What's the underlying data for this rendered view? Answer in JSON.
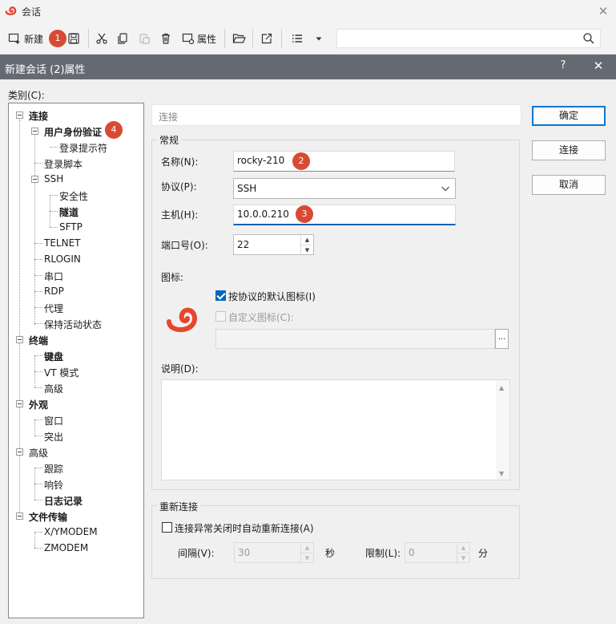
{
  "window": {
    "title": "会话",
    "close_symbol": "✕"
  },
  "toolbar": {
    "new_label": "新建",
    "properties_label": "属性",
    "search_placeholder": ""
  },
  "badges": {
    "b1": "1",
    "b2": "2",
    "b3": "3",
    "b4": "4"
  },
  "dialog": {
    "title": "新建会话 (2)属性",
    "help": "?",
    "close": "✕",
    "category_label": "类别(C):"
  },
  "tree": {
    "connection": "连接",
    "user_auth": "用户身份验证",
    "login_prompt": "登录提示符",
    "login_script": "登录脚本",
    "ssh": "SSH",
    "security": "安全性",
    "tunnel": "隧道",
    "sftp": "SFTP",
    "telnet": "TELNET",
    "rlogin": "RLOGIN",
    "serial": "串口",
    "rdp": "RDP",
    "proxy": "代理",
    "keepalive": "保持活动状态",
    "terminal": "终端",
    "keyboard": "键盘",
    "vt_mode": "VT 模式",
    "terminal_advanced": "高级",
    "appearance": "外观",
    "window": "窗口",
    "highlight": "突出",
    "advanced": "高级",
    "trace": "跟踪",
    "bell": "响铃",
    "logging": "日志记录",
    "file_transfer": "文件传输",
    "xymodem": "X/YMODEM",
    "zmodem": "ZMODEM"
  },
  "form": {
    "section_title": "连接",
    "general_group": "常规",
    "name_label": "名称(N):",
    "name_value": "rocky-210",
    "protocol_label": "协议(P):",
    "protocol_value": "SSH",
    "host_label": "主机(H):",
    "host_value": "10.0.0.210",
    "port_label": "端口号(O):",
    "port_value": "22",
    "icon_label": "图标:",
    "default_icon_label": "按协议的默认图标(I)",
    "custom_icon_label": "自定义图标(C):",
    "browse_label": "...",
    "desc_label": "说明(D):",
    "reconnect_group": "重新连接",
    "auto_reconnect_label": "连接异常关闭时自动重新连接(A)",
    "interval_label": "间隔(V):",
    "interval_value": "30",
    "seconds_unit": "秒",
    "limit_label": "限制(L):",
    "limit_value": "0",
    "minutes_unit": "分"
  },
  "buttons": {
    "ok": "确定",
    "connect": "连接",
    "cancel": "取消"
  },
  "colors": {
    "badge": "#d84a33",
    "dialog_title_bg": "#656a72",
    "accent": "#0078d4",
    "logo": "#e8452c"
  }
}
